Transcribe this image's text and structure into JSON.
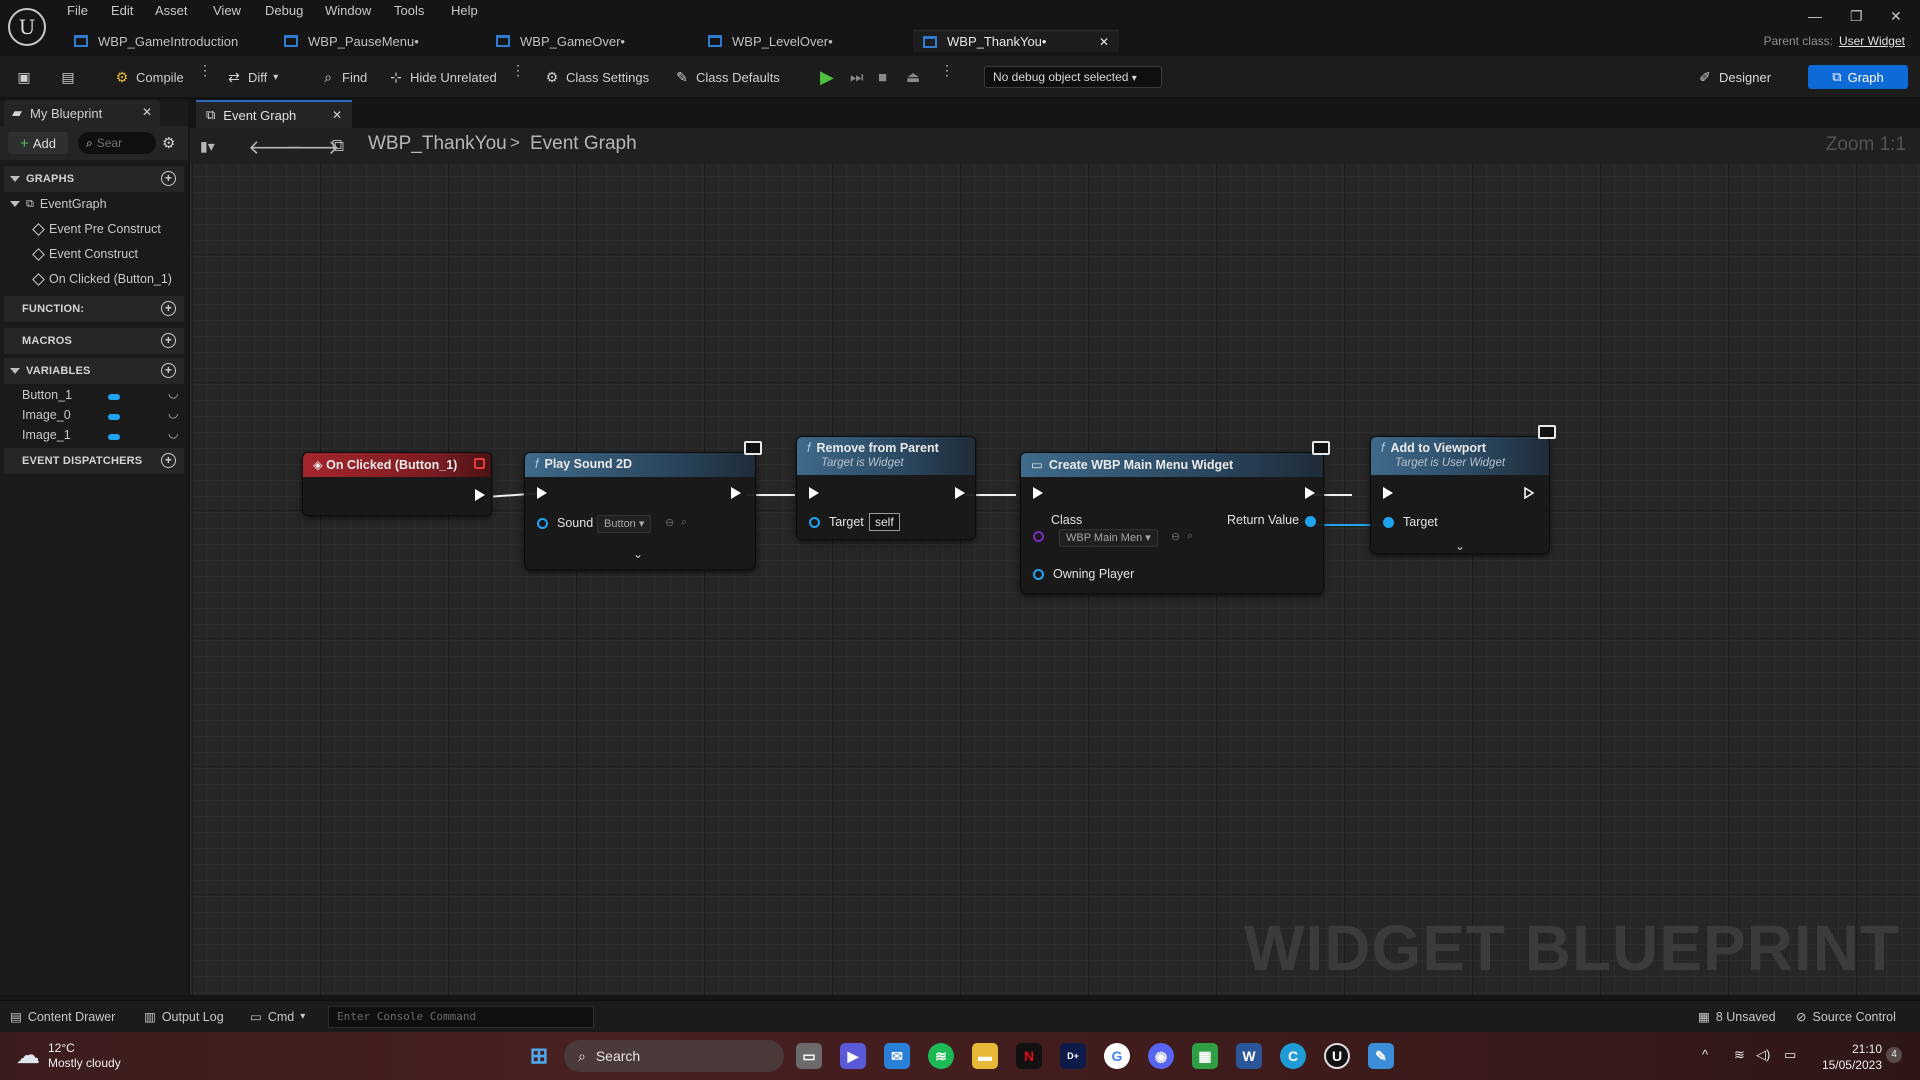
{
  "menu": [
    "File",
    "Edit",
    "Asset",
    "View",
    "Debug",
    "Window",
    "Tools",
    "Help"
  ],
  "tabs": [
    {
      "label": "WBP_GameIntroduction"
    },
    {
      "label": "WBP_PauseMenu•"
    },
    {
      "label": "WBP_GameOver•"
    },
    {
      "label": "WBP_LevelOver•"
    },
    {
      "label": "WBP_ThankYou•"
    }
  ],
  "parent_class": {
    "label": "Parent class:",
    "value": "User Widget"
  },
  "toolbar": {
    "compile": "Compile",
    "diff": "Diff",
    "find": "Find",
    "hide_unrelated": "Hide Unrelated",
    "class_settings": "Class Settings",
    "class_defaults": "Class Defaults",
    "debug_object": "No debug object selected",
    "designer": "Designer",
    "graph": "Graph"
  },
  "my_blueprint": {
    "tab": "My Blueprint",
    "add": "Add",
    "search_placeholder": "Sear",
    "sections": {
      "graphs": "GRAPHS",
      "functions": "FUNCTION:",
      "macros": "MACROS",
      "variables": "VARIABLES",
      "dispatchers": "EVENT DISPATCHERS"
    },
    "event_graph": "EventGraph",
    "events": [
      "Event Pre Construct",
      "Event Construct",
      "On Clicked (Button_1)"
    ],
    "variables": [
      "Button_1",
      "Image_0",
      "Image_1"
    ]
  },
  "graph": {
    "tab": "Event Graph",
    "breadcrumb_root": "WBP_ThankYou",
    "breadcrumb_sep": ">",
    "breadcrumb_graph": "Event Graph",
    "zoom": "Zoom 1:1",
    "watermark": "WIDGET BLUEPRINT"
  },
  "nodes": {
    "on_clicked": {
      "title": "On Clicked (Button_1)"
    },
    "play_sound": {
      "title": "Play Sound 2D",
      "pin_sound": "Sound",
      "sound_value": "Button"
    },
    "remove_parent": {
      "title": "Remove from Parent",
      "subtitle": "Target is Widget",
      "pin_target": "Target",
      "target_value": "self"
    },
    "create_widget": {
      "title": "Create WBP Main Menu Widget",
      "pin_class": "Class",
      "class_value": "WBP Main Men",
      "pin_return": "Return Value",
      "pin_owning": "Owning Player"
    },
    "add_viewport": {
      "title": "Add to Viewport",
      "subtitle": "Target is User Widget",
      "pin_target": "Target"
    }
  },
  "statusbar": {
    "content_drawer": "Content Drawer",
    "output_log": "Output Log",
    "cmd": "Cmd",
    "console_placeholder": "Enter Console Command",
    "unsaved": "8 Unsaved",
    "source_control": "Source Control"
  },
  "taskbar": {
    "temp": "12°C",
    "weather": "Mostly cloudy",
    "search": "Search",
    "time": "21:10",
    "date": "15/05/2023",
    "notif_count": "4"
  }
}
